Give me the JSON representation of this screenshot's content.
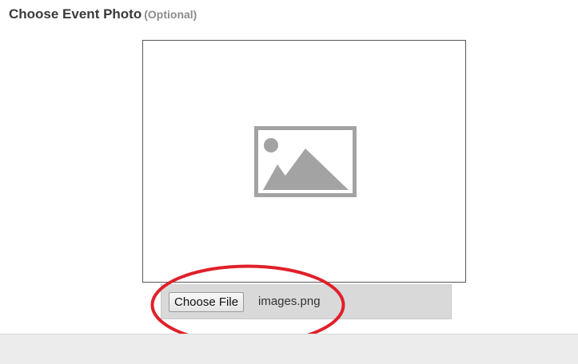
{
  "header": {
    "title": "Choose Event Photo",
    "optional_label": "(Optional)"
  },
  "photo_preview": {
    "placeholder_icon": "image-placeholder-icon"
  },
  "file_input": {
    "button_label": "Choose File",
    "file_name": "images.png"
  },
  "annotation": {
    "shape": "ellipse",
    "color": "#e0202a"
  },
  "colors": {
    "title_text": "#3a3a3a",
    "optional_text": "#8c8c8c",
    "icon_gray": "#a3a3a3",
    "file_bar_bg": "#d9d9d9",
    "footer_bg": "#ececec"
  }
}
